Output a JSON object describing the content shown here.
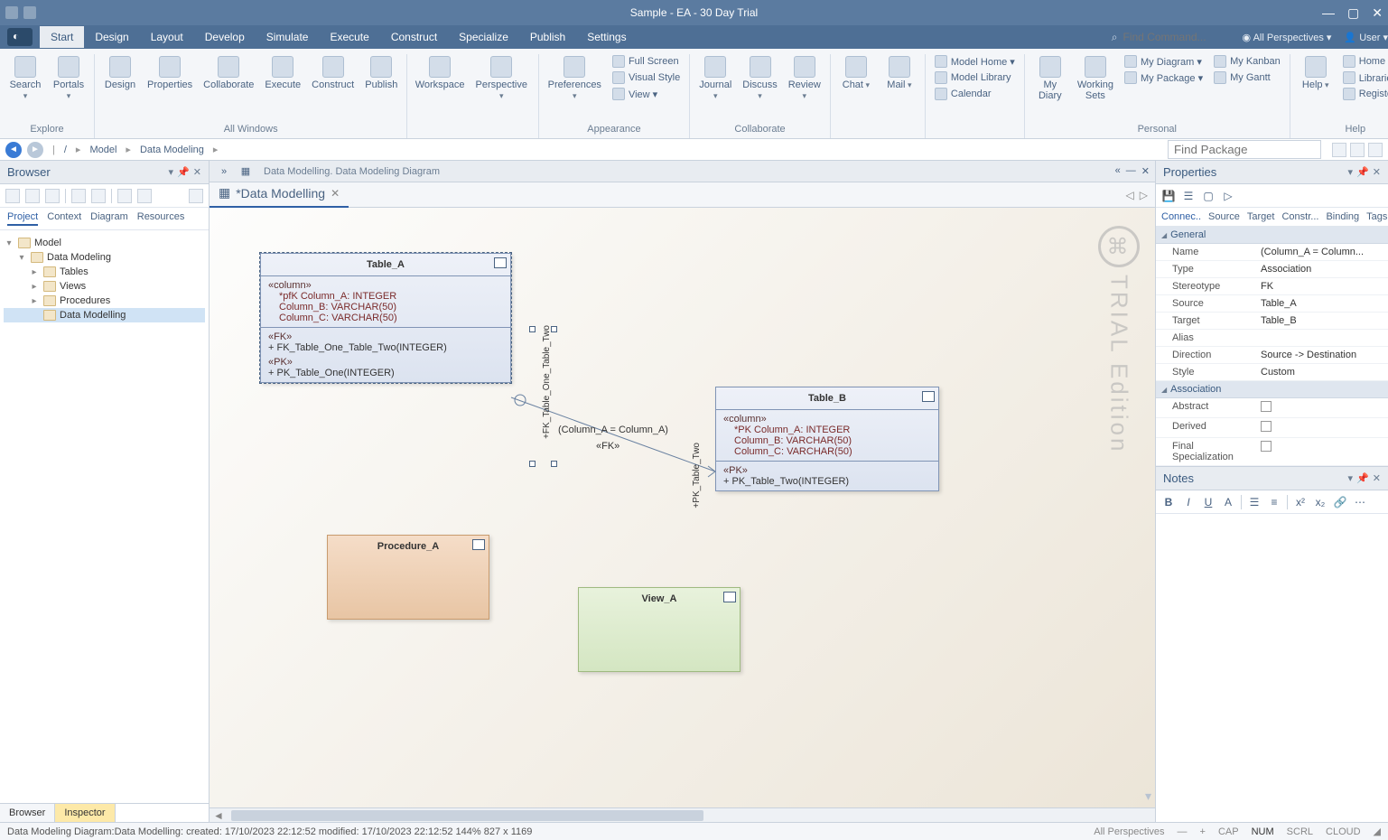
{
  "titlebar": {
    "title": "Sample - EA - 30 Day Trial"
  },
  "menubar": {
    "tabs": [
      "Start",
      "Design",
      "Layout",
      "Develop",
      "Simulate",
      "Execute",
      "Construct",
      "Specialize",
      "Publish",
      "Settings"
    ],
    "active": 0,
    "find_placeholder": "Find Command...",
    "perspectives": "All Perspectives",
    "user": "User"
  },
  "ribbon": {
    "groups": [
      {
        "label": "Explore",
        "buttons": [
          {
            "label": "Search",
            "dd": true
          },
          {
            "label": "Portals",
            "dd": true
          }
        ]
      },
      {
        "label": "All Windows",
        "buttons": [
          {
            "label": "Design"
          },
          {
            "label": "Properties"
          },
          {
            "label": "Collaborate"
          },
          {
            "label": "Execute"
          },
          {
            "label": "Construct"
          },
          {
            "label": "Publish"
          }
        ]
      },
      {
        "label": "",
        "buttons": [
          {
            "label": "Workspace"
          },
          {
            "label": "Perspective",
            "dd": true
          }
        ]
      },
      {
        "label": "Appearance",
        "buttons": [
          {
            "label": "Preferences",
            "dd": true
          }
        ],
        "small": [
          {
            "label": "Full Screen"
          },
          {
            "label": "Visual Style"
          },
          {
            "label": "View",
            "dd": true
          }
        ]
      },
      {
        "label": "Collaborate",
        "buttons": [
          {
            "label": "Journal",
            "dd": true
          },
          {
            "label": "Discuss",
            "dd": true
          },
          {
            "label": "Review",
            "dd": true
          }
        ]
      },
      {
        "label": "",
        "buttons": [
          {
            "label": "Chat",
            "dd": true
          },
          {
            "label": "Mail",
            "dd": true
          }
        ]
      },
      {
        "label": "",
        "small": [
          {
            "label": "Model Home",
            "dd": true
          },
          {
            "label": "Model Library"
          },
          {
            "label": "Calendar"
          }
        ]
      },
      {
        "label": "Personal",
        "buttons": [
          {
            "label": "My Diary"
          },
          {
            "label": "Working Sets"
          }
        ],
        "small": [
          {
            "label": "My Diagram",
            "dd": true
          },
          {
            "label": "My Package",
            "dd": true
          }
        ],
        "small2": [
          {
            "label": "My Kanban"
          },
          {
            "label": "My Gantt"
          }
        ]
      },
      {
        "label": "Help",
        "buttons": [
          {
            "label": "Help",
            "dd": true
          }
        ],
        "small": [
          {
            "label": "Home Page"
          },
          {
            "label": "Libraries",
            "dd": true
          },
          {
            "label": "Register"
          }
        ]
      }
    ]
  },
  "crumb": {
    "items": [
      "/",
      "Model",
      "Data Modeling"
    ],
    "find_placeholder": "Find Package"
  },
  "browser": {
    "title": "Browser",
    "tabs": [
      "Project",
      "Context",
      "Diagram",
      "Resources"
    ],
    "active_tab": 0,
    "tree": [
      {
        "ind": 0,
        "exp": "▾",
        "icon": "pkg",
        "label": "Model"
      },
      {
        "ind": 1,
        "exp": "▾",
        "icon": "pkg",
        "label": "Data Modeling"
      },
      {
        "ind": 2,
        "exp": "▸",
        "icon": "pkg",
        "label": "Tables"
      },
      {
        "ind": 2,
        "exp": "▸",
        "icon": "pkg",
        "label": "Views"
      },
      {
        "ind": 2,
        "exp": "▸",
        "icon": "pkg",
        "label": "Procedures"
      },
      {
        "ind": 2,
        "exp": "",
        "icon": "dia",
        "label": "Data Modelling",
        "sel": true
      }
    ],
    "bottom": [
      "Browser",
      "Inspector"
    ]
  },
  "canvas": {
    "tabbar_path": "Data Modelling.  Data Modeling Diagram",
    "doctab": "*Data Modelling",
    "watermark": "TRIAL Edition",
    "table_a": {
      "name": "Table_A",
      "col_hdr": "«column»",
      "cols": [
        "*pfK Column_A: INTEGER",
        "       Column_B: VARCHAR(50)",
        "       Column_C: VARCHAR(50)"
      ],
      "fk_hdr": "«FK»",
      "fks": [
        "+    FK_Table_One_Table_Two(INTEGER)"
      ],
      "pk_hdr": "«PK»",
      "pks": [
        "+    PK_Table_One(INTEGER)"
      ]
    },
    "table_b": {
      "name": "Table_B",
      "col_hdr": "«column»",
      "cols": [
        "*PK Column_A: INTEGER",
        "       Column_B: VARCHAR(50)",
        "       Column_C: VARCHAR(50)"
      ],
      "pk_hdr": "«PK»",
      "pks": [
        "+    PK_Table_Two(INTEGER)"
      ]
    },
    "proc": {
      "name": "Procedure_A"
    },
    "view": {
      "name": "View_A"
    },
    "conn": {
      "label_top": "(Column_A = Column_A)",
      "label_mid": "«FK»",
      "end_a": "+FK_Table_One_Table_Two",
      "end_b": "+PK_Table_Two"
    }
  },
  "properties": {
    "title": "Properties",
    "tabs": [
      "Connec..",
      "Source",
      "Target",
      "Constr...",
      "Binding",
      "Tags"
    ],
    "active_tab": 0,
    "general_hdr": "General",
    "general": [
      {
        "k": "Name",
        "v": "(Column_A = Column..."
      },
      {
        "k": "Type",
        "v": "Association"
      },
      {
        "k": "Stereotype",
        "v": "FK"
      },
      {
        "k": "Source",
        "v": "Table_A"
      },
      {
        "k": "Target",
        "v": "Table_B"
      },
      {
        "k": "Alias",
        "v": ""
      },
      {
        "k": "Direction",
        "v": "Source -> Destination"
      },
      {
        "k": "Style",
        "v": "Custom"
      }
    ],
    "assoc_hdr": "Association",
    "assoc": [
      {
        "k": "Abstract",
        "chk": true
      },
      {
        "k": "Derived",
        "chk": true
      },
      {
        "k": "Final Specialization",
        "chk": true
      }
    ]
  },
  "notes": {
    "title": "Notes"
  },
  "status": {
    "left": "Data Modeling Diagram:Data Modelling:   created: 17/10/2023 22:12:52   modified: 17/10/2023 22:12:52   144%   827 x 1169",
    "persp": "All Perspectives",
    "indicators": [
      "CAP",
      "NUM",
      "SCRL",
      "CLOUD"
    ]
  }
}
